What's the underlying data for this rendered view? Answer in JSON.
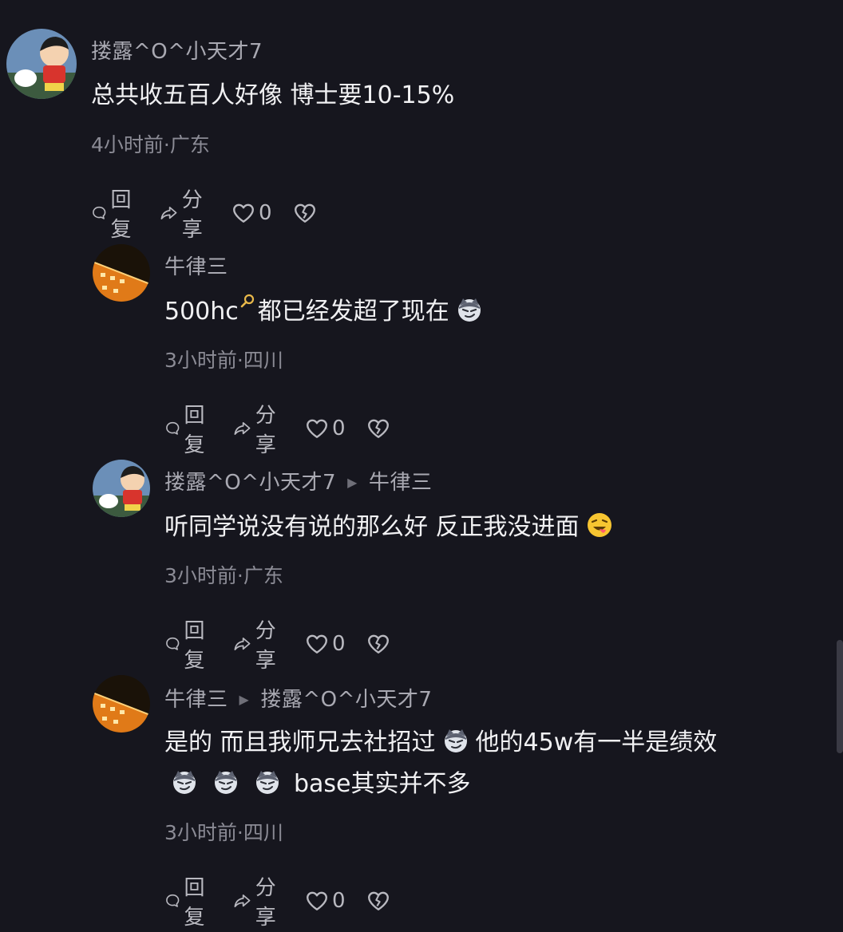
{
  "comments": [
    {
      "username": "搂露^O^小天才7",
      "reply_to": "",
      "text": "总共收五百人好像 博士要10-15%",
      "meta": "4小时前·广东",
      "actions": {
        "reply": "回复",
        "share": "分享",
        "likes": "0"
      }
    },
    {
      "username": "牛律三",
      "reply_to": "",
      "text_pre": "500hc",
      "text_post": "都已经发超了现在",
      "meta": "3小时前·四川",
      "actions": {
        "reply": "回复",
        "share": "分享",
        "likes": "0"
      }
    },
    {
      "username": "搂露^O^小天才7",
      "reply_to": "牛律三",
      "text": "听同学说没有说的那么好 反正我没进面",
      "meta": "3小时前·广东",
      "actions": {
        "reply": "回复",
        "share": "分享",
        "likes": "0"
      }
    },
    {
      "username": "牛律三",
      "reply_to": "搂露^O^小天才7",
      "text_line1_a": "是的 而且我师兄去社招过",
      "text_line1_b": "他的45w有一半是绩效",
      "text_line2": "base其实并不多",
      "meta": "3小时前·四川",
      "actions": {
        "reply": "回复",
        "share": "分享",
        "likes": "0"
      }
    }
  ],
  "icons": {
    "reply": "comment-bubble-icon",
    "share": "share-arrow-icon",
    "like": "heart-icon",
    "dislike": "broken-heart-icon",
    "search_hint": "search-icon",
    "emoji_smirk": "smirk-dog-emoji",
    "emoji_laugh": "tongue-out-emoji"
  },
  "colors": {
    "background": "#16161e",
    "username": "#a9a9b2",
    "text": "#f1f1f3",
    "meta": "#8b8b95",
    "accent_search": "#e8b84a"
  }
}
